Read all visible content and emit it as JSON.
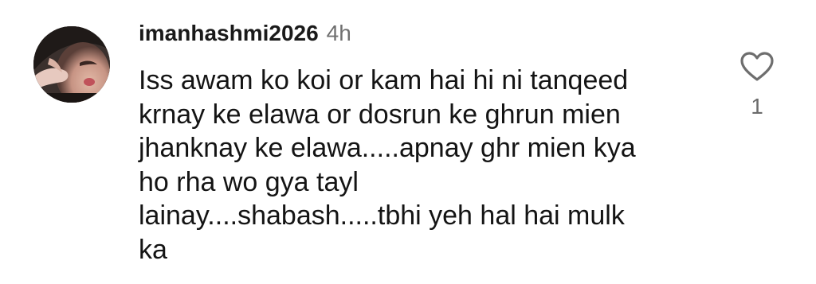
{
  "comment": {
    "username": "imanhashmi2026",
    "timestamp": "4h",
    "text": "Iss awam ko koi or kam hai hi ni tanqeed\nkrnay ke elawa or dosrun ke ghrun mien\njhanknay ke elawa.....apnay ghr mien kya\nho rha wo gya tayl\nlainay....shabash.....tbhi yeh hal hai mulk\nka",
    "like_count": "1",
    "avatar_icon": "user-avatar",
    "like_icon": "heart-outline-icon"
  }
}
